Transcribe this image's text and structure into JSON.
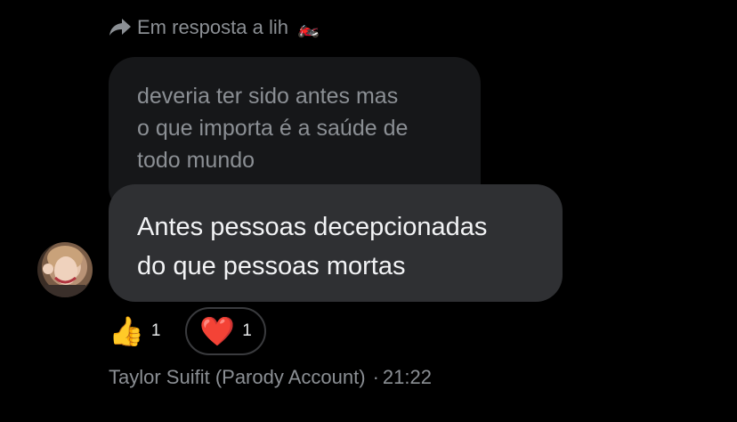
{
  "reply_header": {
    "label": "Em resposta a lih",
    "icon": "share-arrow-icon",
    "emoji": "🏍️"
  },
  "quoted_message": {
    "lines": [
      "deveria ter sido antes mas",
      "o que importa é a saúde de",
      "todo mundo"
    ]
  },
  "message": {
    "lines": [
      "Antes pessoas decepcionadas",
      "do que pessoas mortas"
    ]
  },
  "reactions": [
    {
      "emoji": "👍",
      "count": "1"
    },
    {
      "emoji": "❤️",
      "count": "1"
    }
  ],
  "sender": {
    "name": "Taylor Suifit (Parody Account)",
    "separator": "·",
    "time": "21:22"
  },
  "colors": {
    "background": "#000000",
    "quoted_bubble": "#161719",
    "message_bubble": "#2f3033",
    "muted_text": "#8b8f94"
  }
}
